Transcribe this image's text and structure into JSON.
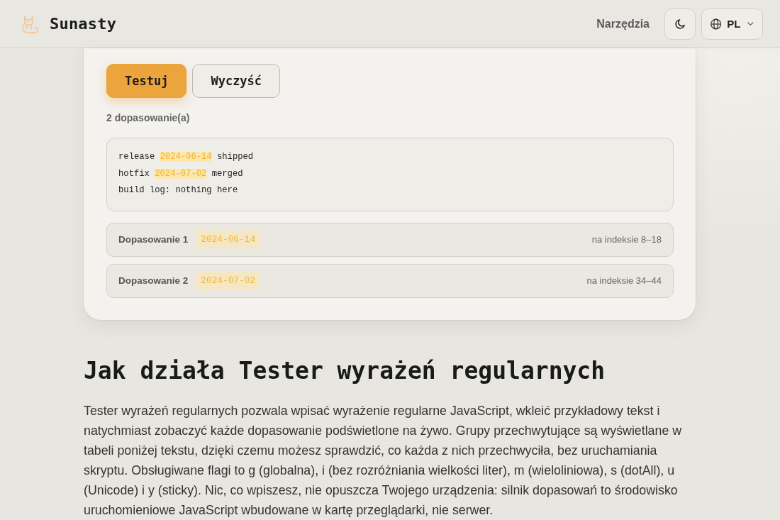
{
  "header": {
    "brand": "Sunasty",
    "nav_link": "Narzędzia",
    "language": "PL"
  },
  "actions": [
    {
      "label": "Testuj",
      "kind": "primary"
    },
    {
      "label": "Wyczyść",
      "kind": "secondary"
    }
  ],
  "match_count": "2 dopasowanie(a)",
  "test_text": {
    "lines": [
      {
        "segments": [
          {
            "text": "release ",
            "highlighted": false
          },
          {
            "text": "2024-06-14",
            "highlighted": true
          },
          {
            "text": " shipped",
            "highlighted": false
          }
        ]
      },
      {
        "segments": [
          {
            "text": "hotfix ",
            "highlighted": false
          },
          {
            "text": "2024-07-02",
            "highlighted": true
          },
          {
            "text": " merged",
            "highlighted": false
          }
        ]
      },
      {
        "segments": [
          {
            "text": "build log: nothing here",
            "highlighted": false
          }
        ]
      }
    ]
  },
  "matches": [
    {
      "label": "Dopasowanie 1",
      "value": "2024-06-14",
      "position": "na indeksie 8–18"
    },
    {
      "label": "Dopasowanie 2",
      "value": "2024-07-02",
      "position": "na indeksie 34–44"
    }
  ],
  "article": {
    "heading": "Jak działa Tester wyrażeń regularnych",
    "paragraph": "Tester wyrażeń regularnych pozwala wpisać wyrażenie regularne JavaScript, wkleić przykładowy tekst i natychmiast zobaczyć każde dopasowanie podświetlone na żywo. Grupy przechwytujące są wyświetlane w tabeli poniżej tekstu, dzięki czemu możesz sprawdzić, co każda z nich przechwyciła, bez uruchamiania skryptu. Obsługiwane flagi to g (globalna), i (bez rozróżniania wielkości liter), m (wieloliniowa), s (dotAll), u (Unicode) i y (sticky). Nic, co wpiszesz, nie opuszcza Twojego urządzenia: silnik dopasowań to środowisko uruchomieniowe JavaScript wbudowane w kartę przeglądarki, nie serwer."
  }
}
